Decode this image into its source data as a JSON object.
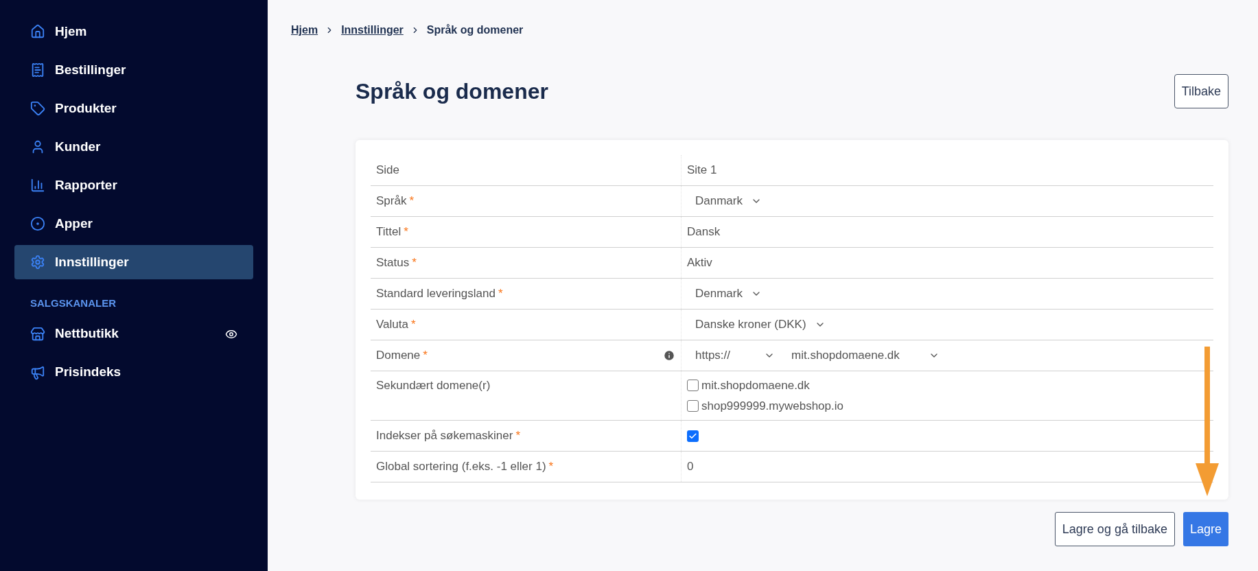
{
  "sidebar": {
    "items": [
      {
        "label": "Hjem",
        "selected": false
      },
      {
        "label": "Bestillinger",
        "selected": false
      },
      {
        "label": "Produkter",
        "selected": false
      },
      {
        "label": "Kunder",
        "selected": false
      },
      {
        "label": "Rapporter",
        "selected": false
      },
      {
        "label": "Apper",
        "selected": false
      },
      {
        "label": "Innstillinger",
        "selected": true
      }
    ],
    "section_title": "SALGSKANALER",
    "channels": [
      {
        "label": "Nettbutikk",
        "preview": true
      },
      {
        "label": "Prisindeks",
        "preview": false
      }
    ]
  },
  "breadcrumb": [
    {
      "label": "Hjem",
      "link": true
    },
    {
      "label": "Innstillinger",
      "link": true
    },
    {
      "label": "Språk og domener",
      "link": false
    }
  ],
  "page_title": "Språk og domener",
  "back_button": "Tilbake",
  "form": {
    "rows": [
      {
        "label": "Side",
        "kind": "text",
        "value": "Site 1"
      },
      {
        "label": "Språk",
        "mark": "*",
        "kind": "select",
        "value": "Danmark"
      },
      {
        "label": "Tittel",
        "mark": "*",
        "kind": "text",
        "value": "Dansk"
      },
      {
        "label": "Status",
        "mark": "*",
        "kind": "text",
        "value": "Aktiv"
      },
      {
        "label": "Standard leveringsland",
        "mark": "*",
        "kind": "select",
        "value": "Denmark"
      },
      {
        "label": "Valuta",
        "mark": "*",
        "kind": "select",
        "value": "Danske kroner (DKK)"
      },
      {
        "label": "Domene",
        "mark": "*",
        "kind": "domain",
        "info": true,
        "protocol": "https://",
        "host": "mit.shopdomaene.dk"
      },
      {
        "label": "Sekundært domene(r)",
        "kind": "checklist",
        "options": [
          {
            "label": "mit.shopdomaene.dk",
            "checked": false
          },
          {
            "label": "shop999999.mywebshop.io",
            "checked": false
          }
        ]
      },
      {
        "label": "Indekser på søkemaskiner",
        "mark": "*",
        "kind": "checkbox",
        "checked": true
      },
      {
        "label": "Global sortering (f.eks. -1 eller 1)",
        "mark": "*",
        "kind": "text",
        "value": "0"
      }
    ]
  },
  "actions": [
    {
      "label": "Lagre og gå tilbake",
      "primary": false
    },
    {
      "label": "Lagre",
      "primary": true
    }
  ]
}
